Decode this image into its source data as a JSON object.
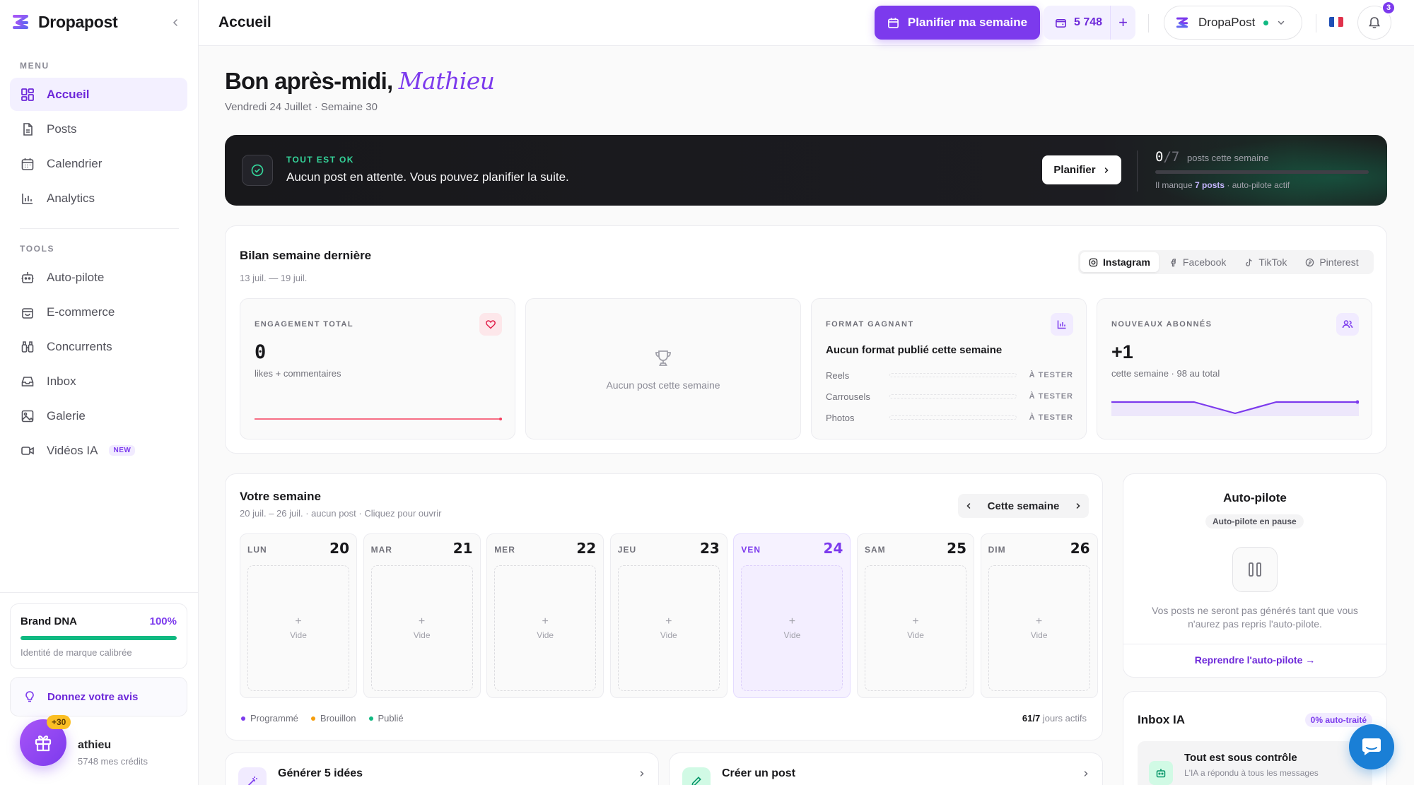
{
  "app": {
    "name": "Dropapost"
  },
  "sidebar": {
    "menu_title": "MENU",
    "tools_title": "TOOLS",
    "menu_items": [
      {
        "label": "Accueil",
        "icon": "dashboard-icon",
        "active": true
      },
      {
        "label": "Posts",
        "icon": "document-icon"
      },
      {
        "label": "Calendrier",
        "icon": "calendar-icon"
      },
      {
        "label": "Analytics",
        "icon": "bar-chart-icon"
      }
    ],
    "tool_items": [
      {
        "label": "Auto-pilote",
        "icon": "robot-icon"
      },
      {
        "label": "E-commerce",
        "icon": "shopping-bag-icon"
      },
      {
        "label": "Concurrents",
        "icon": "binoculars-icon"
      },
      {
        "label": "Inbox",
        "icon": "inbox-icon"
      },
      {
        "label": "Galerie",
        "icon": "image-icon"
      },
      {
        "label": "Vidéos IA",
        "icon": "video-icon",
        "badge": "NEW"
      }
    ],
    "brand_dna": {
      "title": "Brand DNA",
      "percent": "100%",
      "progress": 1.0,
      "subtitle": "Identité de marque calibrée"
    },
    "feedback": {
      "label": "Donnez votre avis",
      "icon": "lightbulb-icon"
    },
    "user": {
      "name": "athieu",
      "credits": "5748 mes crédits"
    },
    "gift": {
      "badge": "+30",
      "icon": "gift-icon"
    }
  },
  "topbar": {
    "title": "Accueil",
    "plan_button": "Planifier ma semaine",
    "credits": "5 748",
    "credits_add": "+",
    "account_name": "DropaPost",
    "account_status": "online",
    "notifications_count": "3",
    "language": "fr"
  },
  "greeting": {
    "prefix": "Bon après-midi,",
    "name": "Mathieu",
    "date": "Vendredi 24 Juillet · Semaine 30"
  },
  "banner": {
    "kicker": "TOUT EST OK",
    "message": "Aucun post en attente. Vous pouvez planifier la suite.",
    "button": "Planifier",
    "count_done": "0",
    "count_total": "/7",
    "count_label": "posts cette semaine",
    "progress": 0.0,
    "note_prefix": "Il manque",
    "note_bold": "7 posts",
    "note_suffix": "· auto-pilote actif"
  },
  "last_week": {
    "title": "Bilan semaine dernière",
    "range": "13 juil. — 19 juil.",
    "platforms": [
      "Instagram",
      "Facebook",
      "TikTok",
      "Pinterest"
    ],
    "active_platform": "Instagram",
    "engagement": {
      "kicker": "ENGAGEMENT TOTAL",
      "value": "0",
      "note": "likes + commentaires"
    },
    "no_post": {
      "label": "Aucun post cette semaine"
    },
    "format": {
      "kicker": "FORMAT GAGNANT",
      "title": "Aucun format publié cette semaine",
      "rows": [
        {
          "label": "Reels",
          "tag": "À TESTER"
        },
        {
          "label": "Carrousels",
          "tag": "À TESTER"
        },
        {
          "label": "Photos",
          "tag": "À TESTER"
        }
      ]
    },
    "followers": {
      "kicker": "NOUVEAUX ABONNÉS",
      "value": "+1",
      "note": "cette semaine · 98 au total"
    }
  },
  "week": {
    "title": "Votre semaine",
    "subtitle": "20 juil. – 26 juil. · aucun post · Cliquez pour ouvrir",
    "nav_label": "Cette semaine",
    "empty_label": "Vide",
    "days": [
      {
        "name": "LUN",
        "num": "20"
      },
      {
        "name": "MAR",
        "num": "21"
      },
      {
        "name": "MER",
        "num": "22"
      },
      {
        "name": "JEU",
        "num": "23"
      },
      {
        "name": "VEN",
        "num": "24",
        "today": true
      },
      {
        "name": "SAM",
        "num": "25"
      },
      {
        "name": "DIM",
        "num": "26"
      }
    ],
    "legend": [
      {
        "label": "Programmé",
        "color": "#7c3aed"
      },
      {
        "label": "Brouillon",
        "color": "#f59e0b"
      },
      {
        "label": "Publié",
        "color": "#10b981"
      }
    ],
    "active_days_value": "61/7",
    "active_days_label": "jours actifs"
  },
  "autopilot": {
    "title": "Auto-pilote",
    "status": "Auto-pilote en pause",
    "text": "Vos posts ne seront pas générés tant que vous n'aurez pas repris l'auto-pilote.",
    "link": "Reprendre l'auto-pilote →"
  },
  "inbox": {
    "title": "Inbox IA",
    "badge": "0% auto-traité",
    "item_title": "Tout est sous contrôle",
    "item_sub": "L'IA a répondu à tous les messages"
  },
  "actions": [
    {
      "label": "Générer 5 idées",
      "icon": "magic-wand-icon"
    },
    {
      "label": "Créer un post",
      "icon": "pencil-icon"
    }
  ],
  "colors": {
    "accent": "#7c3aed",
    "success": "#10b981",
    "dark": "#18181b",
    "chat": "#1a7fd6"
  }
}
